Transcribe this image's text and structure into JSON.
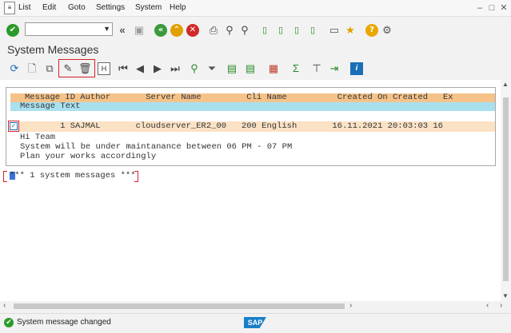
{
  "menu": {
    "items": [
      "List",
      "Edit",
      "Goto",
      "Settings",
      "System",
      "Help"
    ]
  },
  "title": "System Messages",
  "list": {
    "header_line1": "Message ID Author       Server Name         Cli Name          Created On Created   Ex",
    "header_line2": "Message Text",
    "row_main": "       1 SAJMAL       cloudserver_ER2_00   200 English       16.11.2021 20:03:03 16",
    "text_lines": [
      "Hi Team",
      "System will be under maintanance between 06 PM - 07 PM",
      "Plan your works accordingly"
    ],
    "summary": "*** 1 system messages ***"
  },
  "status": {
    "message": "System message changed",
    "brand": "SAP"
  },
  "icons": [
    "enter-icon",
    "back-icon",
    "exit-icon",
    "cancel-icon",
    "print-icon",
    "find-icon",
    "find-next-icon",
    "first-page-icon",
    "previous-page-icon",
    "next-page-icon",
    "last-page-icon",
    "new-session-icon",
    "create-shortcut-icon",
    "help-icon",
    "customize-icon",
    "refresh-icon",
    "create-icon",
    "copy-icon",
    "change-icon",
    "delete-icon",
    "header-icon",
    "filter-icon",
    "sum-icon",
    "info-icon",
    "sap-logo"
  ],
  "colors": {
    "header_orange": "#f5c38a",
    "header_blue": "#a9e0ee",
    "row_highlight": "#fbe2c5",
    "red_highlight": "#d9212b",
    "green_ok": "#2a9a2a",
    "sap_blue": "#1a7fc8"
  }
}
